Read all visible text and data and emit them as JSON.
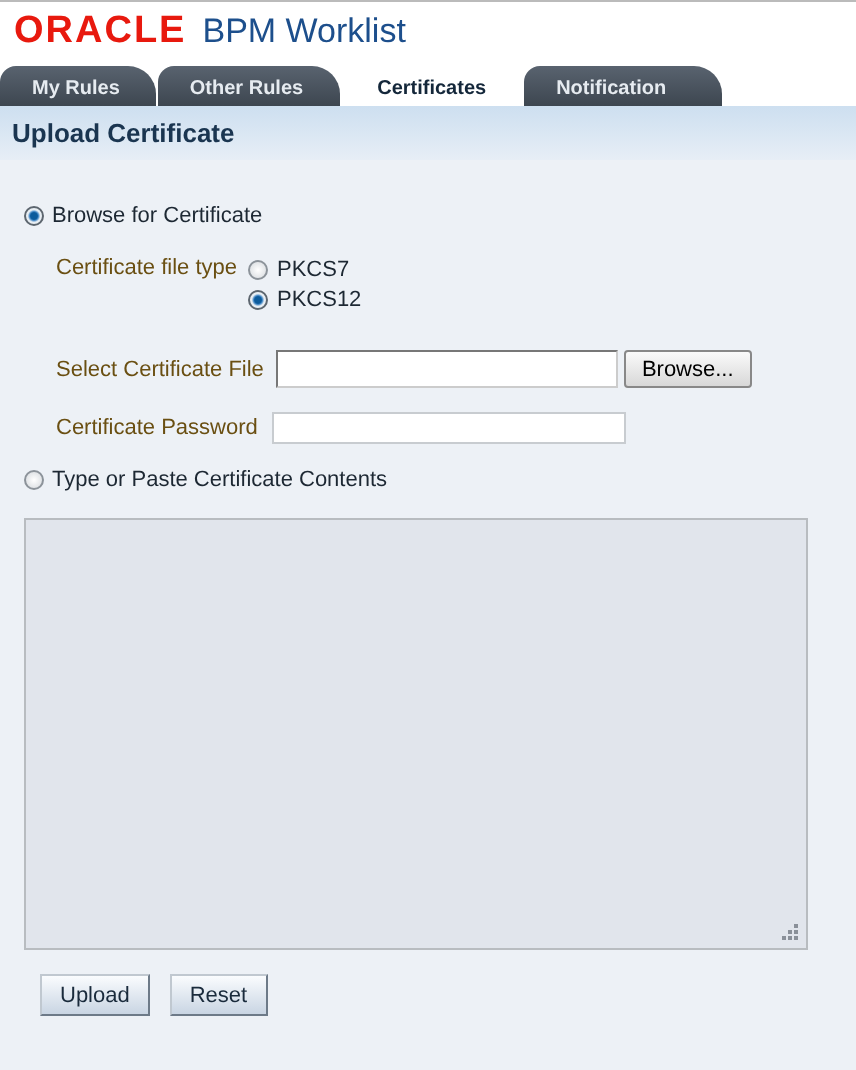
{
  "header": {
    "logo": "ORACLE",
    "title": "BPM Worklist"
  },
  "tabs": [
    {
      "label": "My Rules",
      "selected": false
    },
    {
      "label": "Other Rules",
      "selected": false
    },
    {
      "label": "Certificates",
      "selected": true
    },
    {
      "label": "Notification",
      "selected": false
    }
  ],
  "section_title": "Upload Certificate",
  "sources": [
    {
      "label": "Browse for Certificate",
      "selected": true
    },
    {
      "label": "Type or Paste Certificate Contents",
      "selected": false
    }
  ],
  "file_type": {
    "label": "Certificate file type",
    "options": [
      {
        "label": "PKCS7",
        "selected": false
      },
      {
        "label": "PKCS12",
        "selected": true
      }
    ]
  },
  "file_field": {
    "label": "Select Certificate File",
    "button": "Browse..."
  },
  "password_field": {
    "label": "Certificate Password"
  },
  "contents": {
    "disabled": true
  },
  "buttons": [
    "Upload",
    "Reset"
  ]
}
